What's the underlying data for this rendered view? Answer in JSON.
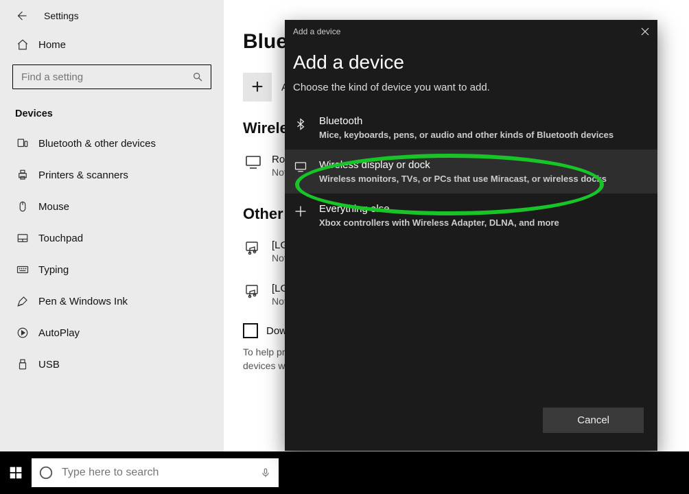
{
  "header": {
    "settings_title": "Settings"
  },
  "sidebar": {
    "home_label": "Home",
    "search_placeholder": "Find a setting",
    "section_label": "Devices",
    "items": [
      {
        "label": "Bluetooth & other devices"
      },
      {
        "label": "Printers & scanners"
      },
      {
        "label": "Mouse"
      },
      {
        "label": "Touchpad"
      },
      {
        "label": "Typing"
      },
      {
        "label": "Pen & Windows Ink"
      },
      {
        "label": "AutoPlay"
      },
      {
        "label": "USB"
      }
    ]
  },
  "main": {
    "page_title": "Bluetooth & other devices",
    "add_label": "Add Bluetooth or other device",
    "section_wireless": "Wireless displays & docks",
    "device1": {
      "name": "Roku",
      "desc": "Not connected"
    },
    "section_other": "Other devices",
    "device2": {
      "name": "[LG] webOS TV",
      "desc": "Not connected"
    },
    "device3": {
      "name": "[LG] webOS TV",
      "desc": "Not connected"
    },
    "metered_label": "Download over metered connections",
    "metered_help": "To help prevent extra charges, keep this off so device software (drivers, info, and apps) for new devices won't download while you're on metered Internet connections."
  },
  "dialog": {
    "title_small": "Add a device",
    "title": "Add a device",
    "subtitle": "Choose the kind of device you want to add.",
    "opts": [
      {
        "title": "Bluetooth",
        "desc": "Mice, keyboards, pens, or audio and other kinds of Bluetooth devices"
      },
      {
        "title": "Wireless display or dock",
        "desc": "Wireless monitors, TVs, or PCs that use Miracast, or wireless docks"
      },
      {
        "title": "Everything else",
        "desc": "Xbox controllers with Wireless Adapter, DLNA, and more"
      }
    ],
    "cancel_label": "Cancel"
  },
  "taskbar": {
    "search_placeholder": "Type here to search"
  }
}
